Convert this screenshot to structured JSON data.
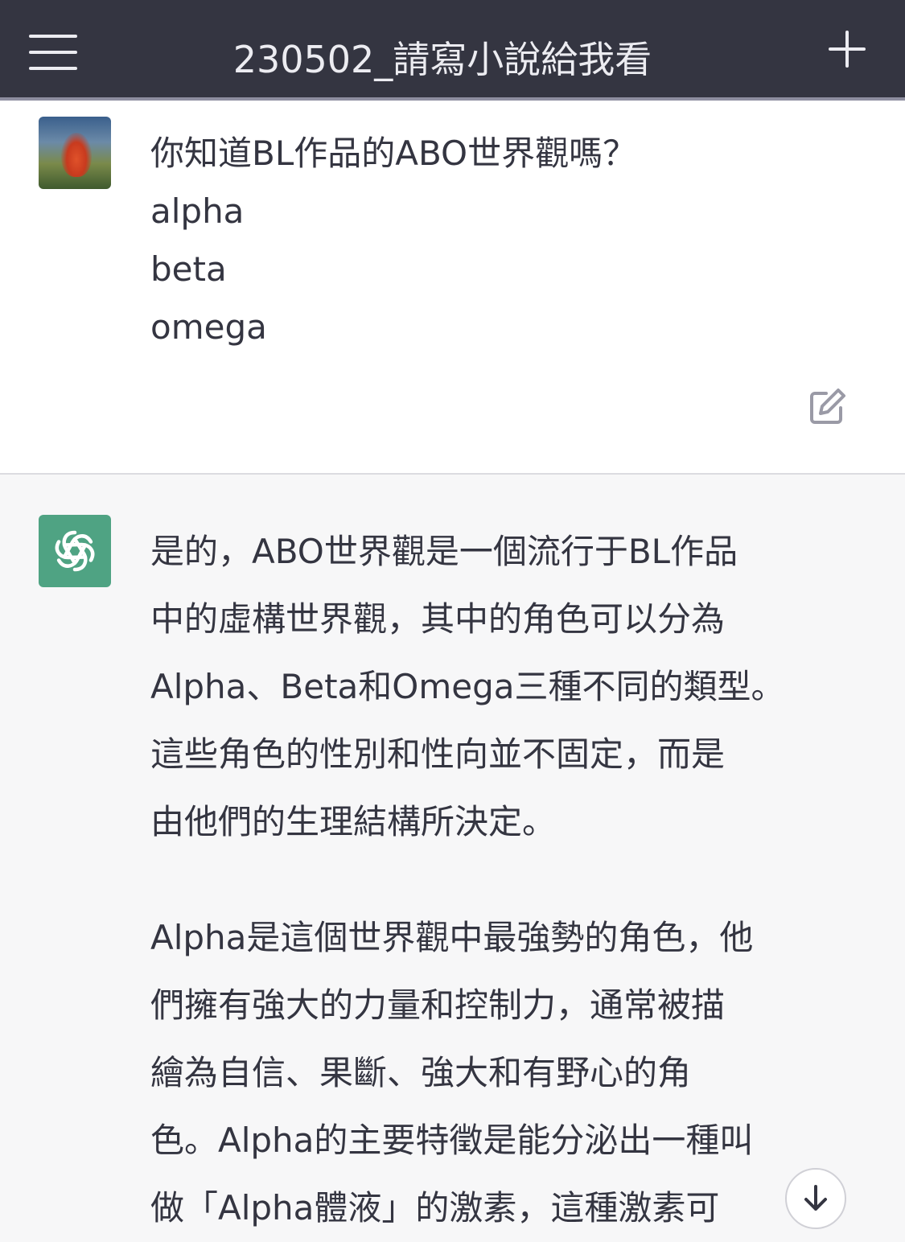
{
  "header": {
    "title": "230502_請寫小說給我看",
    "menu_icon": "hamburger-menu-icon",
    "new_chat_icon": "plus-icon"
  },
  "user_message": {
    "lines": [
      "你知道BL作品的ABO世界觀嗎？",
      "alpha",
      "beta",
      "omega"
    ],
    "edit_icon": "edit-icon"
  },
  "assistant_message": {
    "paragraph1": [
      "是的，ABO世界觀是一個流行于BL作品",
      "中的虛構世界觀，其中的角色可以分為",
      "Alpha、Beta和Omega三種不同的類型。",
      "這些角色的性別和性向並不固定，而是",
      "由他們的生理結構所決定。"
    ],
    "paragraph2": [
      "Alpha是這個世界觀中最強勢的角色，他",
      "們擁有強大的力量和控制力，通常被描",
      "繪為自信、果斷、強大和有野心的角",
      "色。Alpha的主要特徵是能分泌出一種叫",
      "做「Alpha體液」的激素，這種激素可"
    ]
  },
  "scroll_button": {
    "icon": "arrow-down-icon"
  },
  "colors": {
    "header_bg": "#343541",
    "header_text": "#ececf1",
    "user_bg": "#ffffff",
    "assistant_bg": "#f7f7f8",
    "assistant_avatar": "#4fa383"
  }
}
